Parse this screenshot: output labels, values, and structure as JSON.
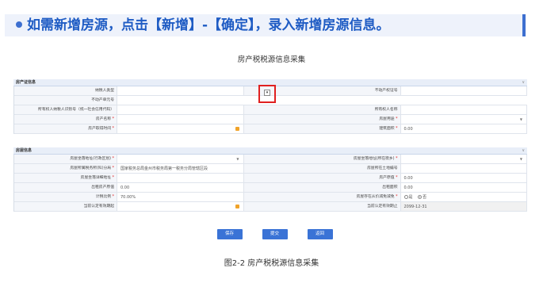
{
  "banner": {
    "text": "如需新增房源，点击【新增】-【确定】，录入新增房源信息。"
  },
  "form_title": "房产税税源信息采集",
  "section1": {
    "title": "房产证信息",
    "rows": [
      {
        "left_label": "纳税人类型",
        "left_value": "",
        "right_label": "不动产权证号",
        "right_value": ""
      },
      {
        "left_label": "不动产单元号",
        "left_value": ""
      },
      {
        "left_label": "所有权人纳税人识别号（统一社会信用代码）",
        "left_value": "",
        "right_label": "所有权人名称",
        "right_value": ""
      },
      {
        "left_label": "房产名称",
        "left_req": "*",
        "left_value": "",
        "right_label": "房屋用途",
        "right_req": "*",
        "right_value": ""
      },
      {
        "left_label": "房产取得时间",
        "left_req": "*",
        "left_value": "",
        "right_label": "建筑面积",
        "right_req": "*",
        "right_value": "0.00"
      }
    ]
  },
  "section2": {
    "title": "房屋信息",
    "rows": [
      {
        "left_label": "房屋坐落地址(行政区划)",
        "left_req": "*",
        "left_value": "",
        "right_label": "房屋坐落地址(所在街乡)",
        "right_req": "*",
        "right_value": ""
      },
      {
        "left_label": "房屋所属税务所(科)分局",
        "left_req": "*",
        "left_value": "国家税务总局金州市税务局第一税务分局管辖区段",
        "right_label": "房屋所在土地编号",
        "right_value": ""
      },
      {
        "left_label": "房屋坐落详细地址",
        "left_req": "*",
        "left_value": "",
        "right_label": "房产原值",
        "right_req": "*",
        "right_value": "0.00"
      },
      {
        "left_label": "出租房产原值",
        "left_value": "0.00",
        "right_label": "出租面积",
        "right_value": "0.00"
      },
      {
        "left_label": "计税比例",
        "left_req": "*",
        "left_value": "70.00%",
        "right_label": "房屋存在从价减免减免",
        "right_req": "*",
        "right_value": ""
      },
      {
        "left_label": "当前认定有效期起",
        "left_value": "",
        "right_label": "当前认定有效期止",
        "right_value": "2099-12-31"
      }
    ],
    "radio": {
      "yes": "是",
      "no": "否"
    }
  },
  "buttons": {
    "save": "保存",
    "submit": "提交",
    "back": "返回"
  },
  "caption": "图2-2 房产税税源信息采集",
  "colors": {
    "accent": "#3d6fd0",
    "highlight": "#e02020",
    "button": "#3a73d6"
  }
}
